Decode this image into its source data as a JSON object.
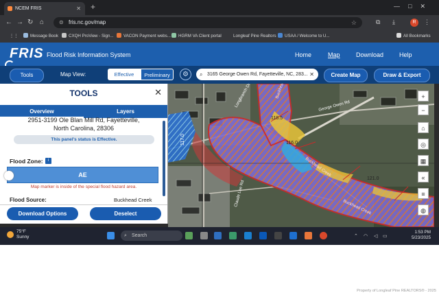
{
  "browser": {
    "tab_title": "NCEM FRIS",
    "url": "fris.nc.gov/map",
    "profile_initial": "R",
    "bookmarks": [
      "Message Book",
      "CXQH ProView - Sign...",
      "VACON Payment webs...",
      "HGRM VA Client portal",
      "Longleaf Pine Realtors",
      "USAA / Welcome to U..."
    ],
    "all_bookmarks": "All Bookmarks"
  },
  "header": {
    "logo": "FRIS",
    "subtitle": "Flood Risk Information System",
    "nav": [
      "Home",
      "Map",
      "Download",
      "Help"
    ],
    "active_nav": "Map"
  },
  "toolbar": {
    "tools_label": "Tools",
    "map_view_label": "Map View:",
    "view_options": [
      "Effective",
      "Preliminary"
    ],
    "selected_view": "Effective",
    "search_value": "3165 George Owen Rd, Fayetteville, NC, 283...",
    "create_map": "Create Map",
    "draw_export": "Draw & Export"
  },
  "panel": {
    "title": "TOOLS",
    "tabs": [
      "Overview",
      "Layers"
    ],
    "active_tab": "Overview",
    "address_line1": "2951-3199 Ole Blan Mill Rd, Fayetteville,",
    "address_line2": "North Carolina, 28306",
    "status_text": "This panel's status is Effective.",
    "flood_zone_label": "Flood Zone:",
    "flood_zone_value": "AE",
    "marker_note": "Map marker is inside of the special flood hazard area.",
    "flood_source_label": "Flood Source:",
    "flood_source_value": "Buckhead Creek",
    "download_options": "Download Options",
    "deselect": "Deselect"
  },
  "map": {
    "labels": [
      "Buckhead Creek",
      "Buckhead Creek",
      "Buckhead Creek",
      "116.0",
      "117.0",
      "118.5",
      "121.0"
    ],
    "road_labels": [
      "Longbranch Dr",
      "Claude Lee Rd",
      "George Owen Rd"
    ],
    "controls": [
      "+",
      "−"
    ],
    "colors": {
      "flood_fill": "#7a6fd0",
      "flood_border": "#cc2a2a",
      "hatch": "#e07a3a",
      "yellow": "#e8c43a",
      "cyan": "#33a9e0"
    }
  },
  "taskbar": {
    "temp": "75°F",
    "condition": "Sunny",
    "search_label": "Search",
    "time": "1:53 PM",
    "date": "5/23/2025"
  },
  "watermark": "Property of Longleaf Pine REALTORS® - 2025"
}
